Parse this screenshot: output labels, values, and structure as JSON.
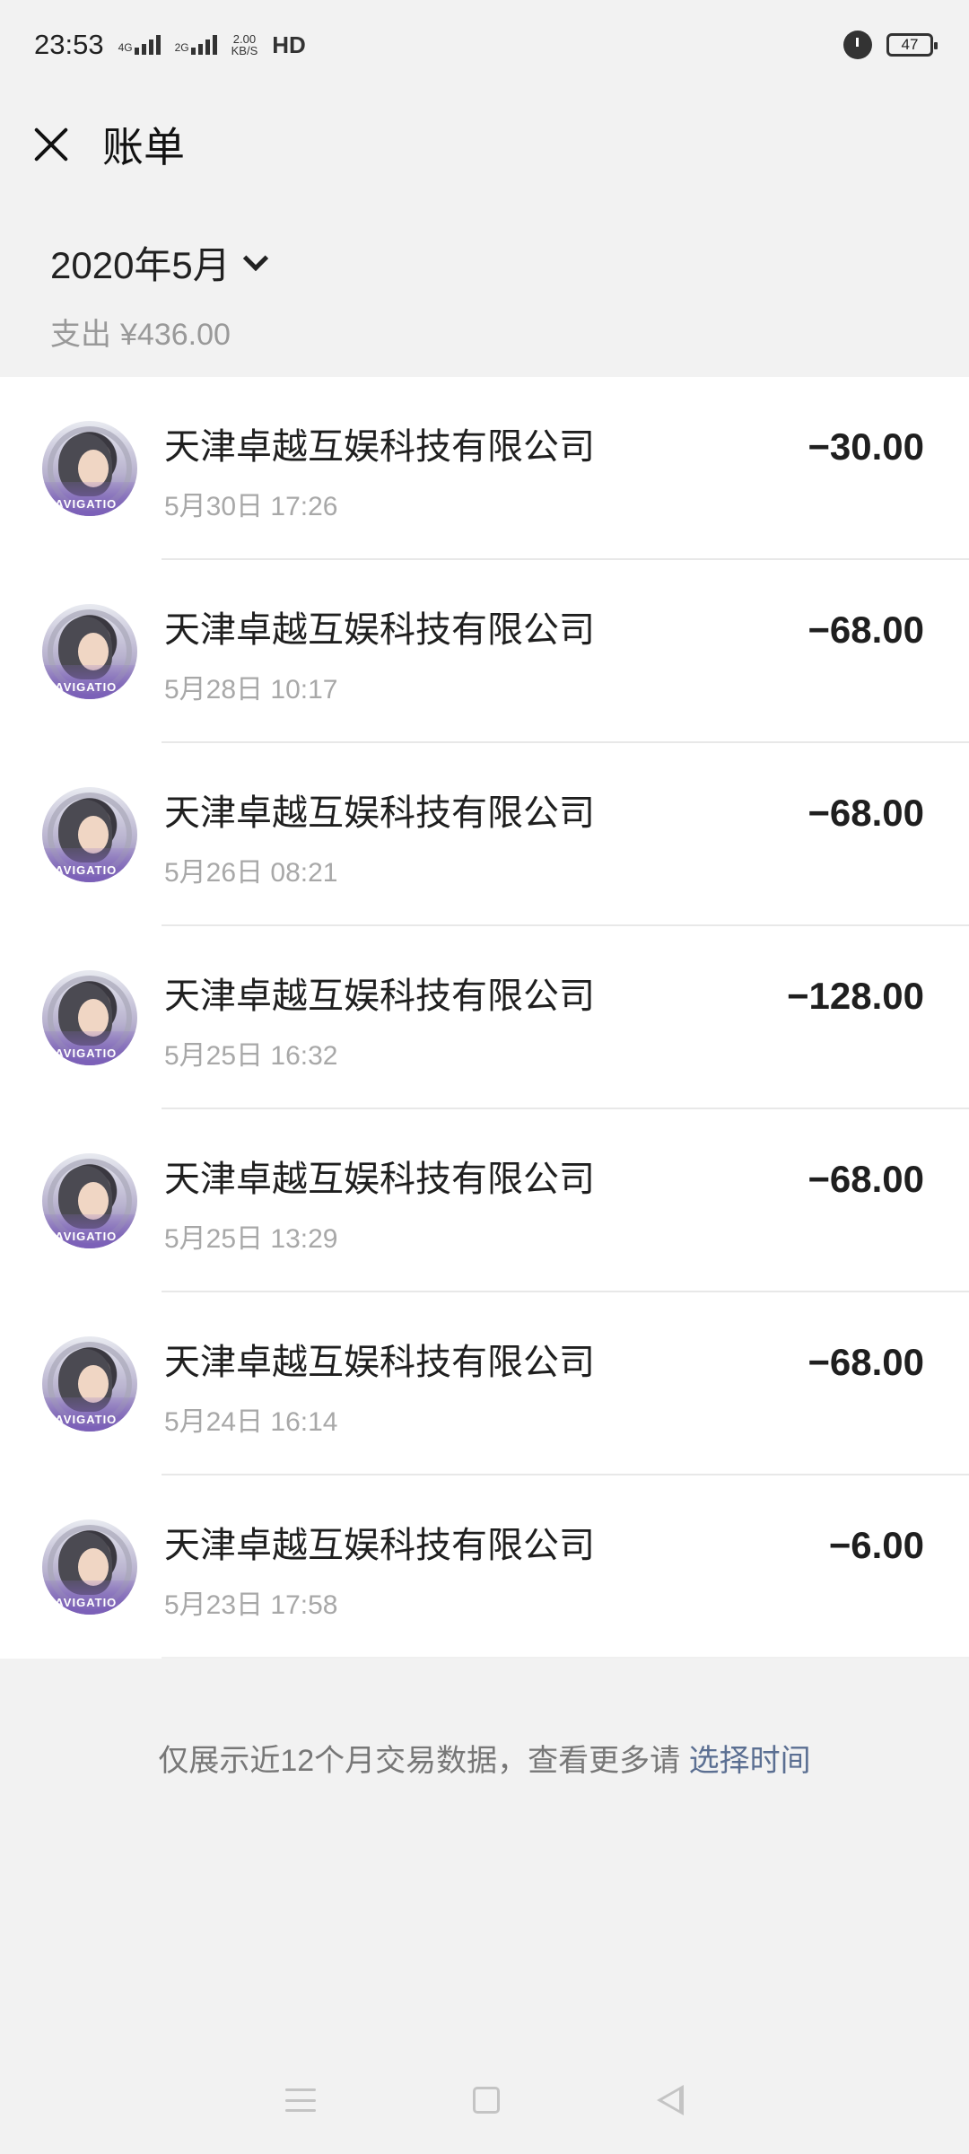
{
  "status_bar": {
    "time": "23:53",
    "network_1": "4G",
    "network_2": "2G",
    "speed_value": "2.00",
    "speed_unit": "KB/S",
    "hd": "HD",
    "battery": "47"
  },
  "header": {
    "title": "账单"
  },
  "summary": {
    "month": "2020年5月",
    "spend_label": "支出",
    "spend_amount": "¥436.00"
  },
  "transactions": [
    {
      "merchant": "天津卓越互娱科技有限公司",
      "time": "5月30日 17:26",
      "amount": "−30.00"
    },
    {
      "merchant": "天津卓越互娱科技有限公司",
      "time": "5月28日 10:17",
      "amount": "−68.00"
    },
    {
      "merchant": "天津卓越互娱科技有限公司",
      "time": "5月26日 08:21",
      "amount": "−68.00"
    },
    {
      "merchant": "天津卓越互娱科技有限公司",
      "time": "5月25日 16:32",
      "amount": "−128.00"
    },
    {
      "merchant": "天津卓越互娱科技有限公司",
      "time": "5月25日 13:29",
      "amount": "−68.00"
    },
    {
      "merchant": "天津卓越互娱科技有限公司",
      "time": "5月24日 16:14",
      "amount": "−68.00"
    },
    {
      "merchant": "天津卓越互娱科技有限公司",
      "time": "5月23日 17:58",
      "amount": "−6.00"
    }
  ],
  "avatar_text": "NAVIGATIO",
  "footer": {
    "note": "仅展示近12个月交易数据，查看更多请 ",
    "link": "选择时间"
  },
  "colors": {
    "background": "#f2f2f2",
    "link": "#5b6f92",
    "muted": "#a8a8a8"
  }
}
